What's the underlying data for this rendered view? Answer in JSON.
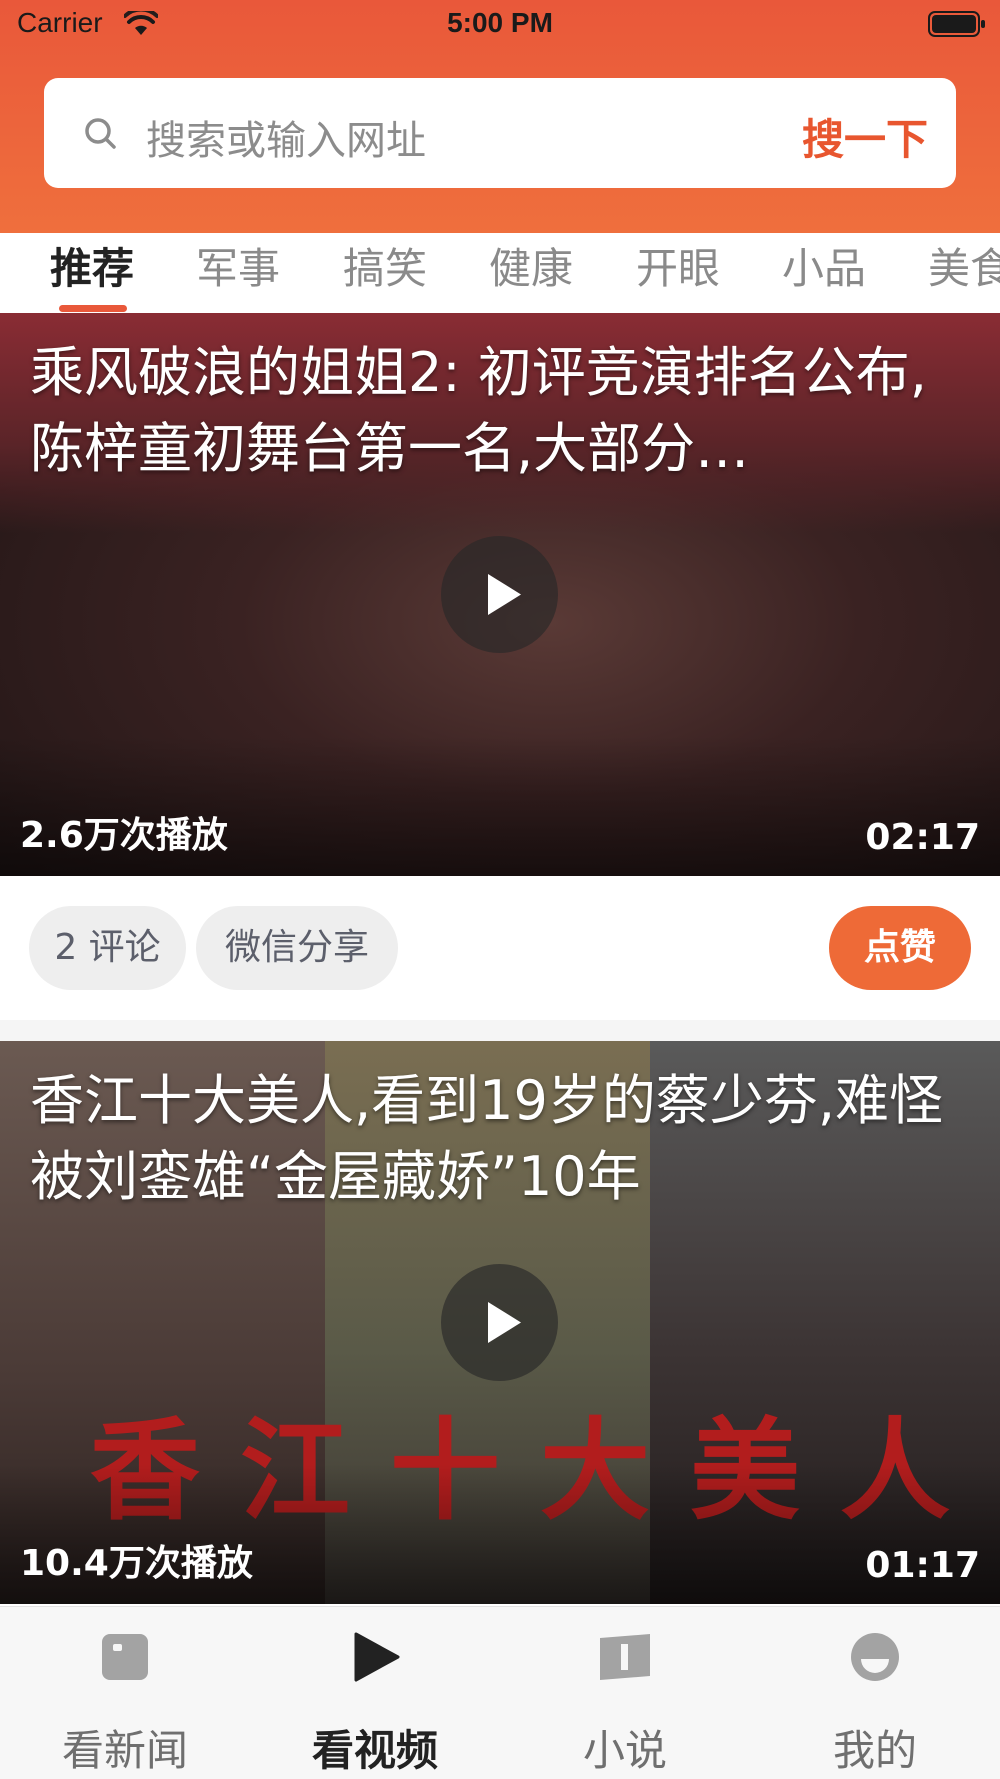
{
  "status_bar": {
    "carrier": "Carrier",
    "time": "5:00 PM"
  },
  "search": {
    "placeholder": "搜索或输入网址",
    "button_label": "搜一下"
  },
  "tabs": [
    {
      "label": "推荐",
      "active": true
    },
    {
      "label": "军事"
    },
    {
      "label": "搞笑"
    },
    {
      "label": "健康"
    },
    {
      "label": "开眼"
    },
    {
      "label": "小品"
    },
    {
      "label": "美食"
    }
  ],
  "videos": [
    {
      "title": "乘风破浪的姐姐2: 初评竞演排名公布,陈梓童初舞台第一名,大部分…",
      "play_count": "2.6万次播放",
      "duration": "02:17"
    },
    {
      "title": "香江十大美人,看到19岁的蔡少芬,难怪被刘銮雄“金屋藏娇”10年",
      "play_count": "10.4万次播放",
      "duration": "01:17",
      "overlay_text": "香江十大美人"
    }
  ],
  "actions": {
    "comments": "2 评论",
    "share": "微信分享",
    "like": "点赞"
  },
  "bottom_nav": [
    {
      "label": "看新闻",
      "icon": "news-icon"
    },
    {
      "label": "看视频",
      "icon": "play-icon",
      "active": true
    },
    {
      "label": "小说",
      "icon": "book-icon"
    },
    {
      "label": "我的",
      "icon": "profile-icon"
    }
  ],
  "colors": {
    "accent": "#e9583a",
    "like_button": "#ee6a37"
  }
}
